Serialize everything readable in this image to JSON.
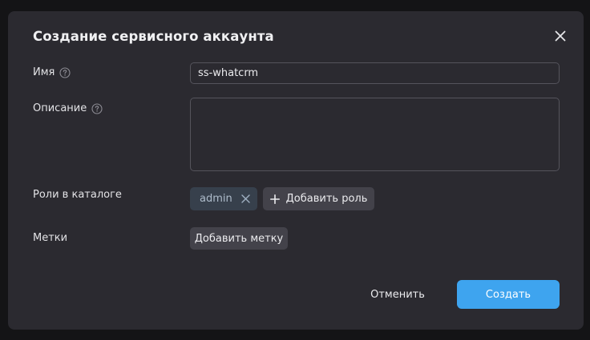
{
  "dialog": {
    "title": "Создание сервисного аккаунта",
    "close_icon": "close-icon"
  },
  "form": {
    "name_label": "Имя",
    "name_value": "ss-whatcrm",
    "description_label": "Описание",
    "description_value": "",
    "roles_label": "Роли в каталоге",
    "roles": [
      {
        "label": "admin"
      }
    ],
    "add_role_label": "Добавить роль",
    "labels_label": "Метки",
    "add_label_label": "Добавить метку",
    "help_icon": "question-circle-icon"
  },
  "footer": {
    "cancel_label": "Отменить",
    "create_label": "Создать"
  },
  "colors": {
    "accent": "#3ea4ef",
    "dialog_bg": "#2b2a30",
    "chip_bg": "#37404c"
  }
}
